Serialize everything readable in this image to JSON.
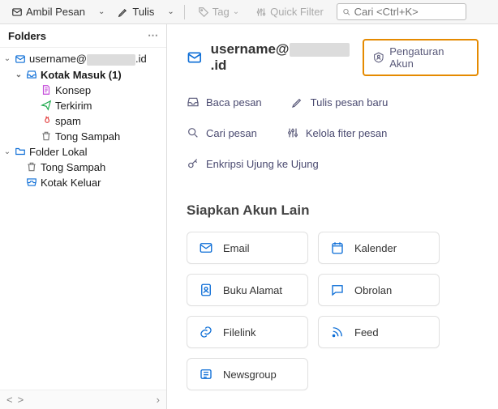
{
  "toolbar": {
    "get_messages": "Ambil Pesan",
    "write": "Tulis",
    "tag": "Tag",
    "quick_filter": "Quick Filter",
    "search_placeholder": "Cari <Ctrl+K>"
  },
  "sidebar": {
    "title": "Folders",
    "account": {
      "label": "username@",
      "suffix": ".id"
    },
    "inbox": "Kotak Masuk (1)",
    "drafts": "Konsep",
    "sent": "Terkirim",
    "spam": "spam",
    "trash": "Tong Sampah",
    "local": "Folder Lokal",
    "local_trash": "Tong Sampah",
    "outbox": "Kotak Keluar"
  },
  "content": {
    "account_prefix": "username@",
    "account_suffix": ".id",
    "settings_btn": "Pengaturan Akun",
    "actions": {
      "read": "Baca pesan",
      "write": "Tulis pesan baru",
      "search": "Cari pesan",
      "filters": "Kelola fiter pesan",
      "e2e": "Enkripsi Ujung ke Ujung"
    },
    "setup_title": "Siapkan Akun Lain",
    "cards": {
      "email": "Email",
      "calendar": "Kalender",
      "contacts": "Buku Alamat",
      "chat": "Obrolan",
      "filelink": "Filelink",
      "feed": "Feed",
      "newsgroup": "Newsgroup"
    }
  }
}
